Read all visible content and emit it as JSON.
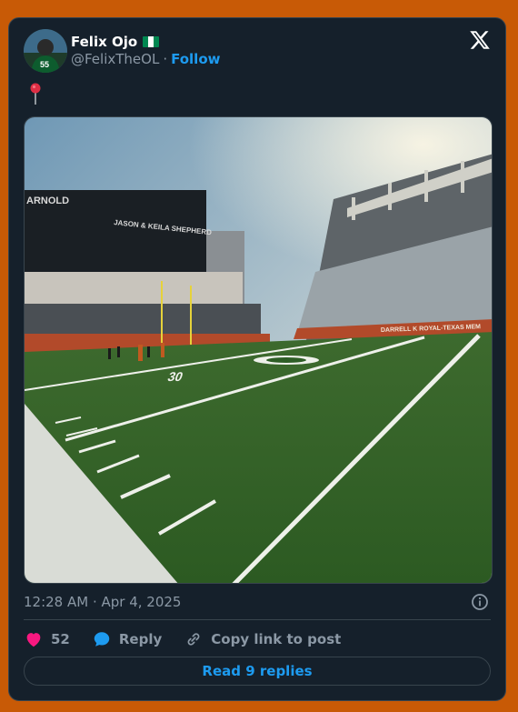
{
  "author": {
    "name": "Felix Ojo",
    "handle": "@FelixTheOL",
    "flag_icon": "nigeria-flag-icon",
    "follow_label": "Follow"
  },
  "tweet": {
    "text_icon": "round-pushpin-icon",
    "timestamp": "12:28 AM · Apr 4, 2025",
    "photo_caption_texts": {
      "scoreboard_name": "ARNOLD",
      "upper_deck_text": "JASON & KEILA SHEPHERD",
      "stadium_banner": "DARRELL K ROYAL-TEXAS MEM",
      "yard_number": "30"
    }
  },
  "actions": {
    "like_count": "52",
    "reply_label": "Reply",
    "copy_label": "Copy link to post"
  },
  "read_replies_label": "Read 9 replies",
  "colors": {
    "background": "#c85a06",
    "card": "#15202b",
    "accent": "#1d9bf0",
    "heart": "#f91880"
  }
}
